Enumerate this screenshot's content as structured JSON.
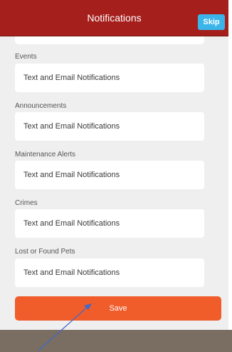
{
  "header": {
    "title": "Notifications",
    "skip_label": "Skip"
  },
  "sections": [
    {
      "label": "Events",
      "value": "Text and Email Notifications"
    },
    {
      "label": "Announcements",
      "value": "Text and Email Notifications"
    },
    {
      "label": "Maintenance Alerts",
      "value": "Text and Email Notifications"
    },
    {
      "label": "Crimes",
      "value": "Text and Email Notifications"
    },
    {
      "label": "Lost or Found Pets",
      "value": "Text and Email Notifications"
    }
  ],
  "save_label": "Save",
  "colors": {
    "header": "#a51f1c",
    "skip": "#3ab5ea",
    "save": "#f15c2b",
    "footer": "#7a6d62",
    "background": "#efefef",
    "annotation_arrow": "#4169c8"
  },
  "icons": {
    "annotation": "arrow-annotation-icon"
  }
}
